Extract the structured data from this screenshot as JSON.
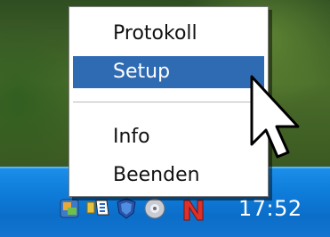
{
  "menu": {
    "items": [
      {
        "label": "Protokoll"
      },
      {
        "label": "Setup"
      },
      {
        "label": "Info"
      },
      {
        "label": "Beenden"
      }
    ],
    "selected_index": 1
  },
  "tray": {
    "clock": "17:52",
    "icons": [
      "tray-app-icon",
      "network-icon",
      "shield-icon",
      "cd-icon",
      "n-icon"
    ]
  },
  "colors": {
    "taskbar": "#0f7fdc",
    "menu_highlight": "#2f6bb3",
    "n_icon": "#e0302a"
  }
}
